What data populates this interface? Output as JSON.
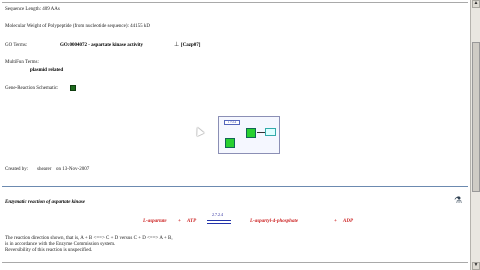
{
  "details": {
    "sequence_length": "Sequence Length: 409 AAs",
    "molecular_weight": "Molecular Weight of Polypeptide (from nucleotide sequence): 44155 kD",
    "go_terms_label": "GO Terms:",
    "go_term_value": "GO:0004072 - aspartate kinase activity",
    "go_term_evidence": "[Cazp07]",
    "multifun_label": "MultiFun Terms:",
    "multifun_value": "plasmid related",
    "gene_reaction_label": "Gene-Reaction Schematic:",
    "created_by": "Created by:",
    "created_by_user": "shearer",
    "created_on": "on 13-Nov-2007"
  },
  "schematic": {
    "node_label": "1 7.2.4",
    "colors": {
      "green": "#28d030",
      "blue": "#5566bb",
      "cyan": "#33aaaa"
    }
  },
  "reaction": {
    "title": "Enzymatic reaction of aspartate kinase",
    "left_substrate": "L-aspartate",
    "plus1": "+",
    "left_cofactor": "ATP",
    "ec_number": "2.7.2.4",
    "right_product": "L-aspartyl-4-phosphate",
    "plus2": "+",
    "right_byproduct": "ADP",
    "note1": "The reaction direction shown, that is,  A + B <==> C + D  versus  C + D <==> A + B,",
    "note2": "is in accordance with the Enzyme Commission system.",
    "note3": "Reversibility of this reaction is unspecified."
  },
  "colors": {
    "reaction_red": "#cc2222",
    "divider_blue": "#6c8ab0"
  }
}
